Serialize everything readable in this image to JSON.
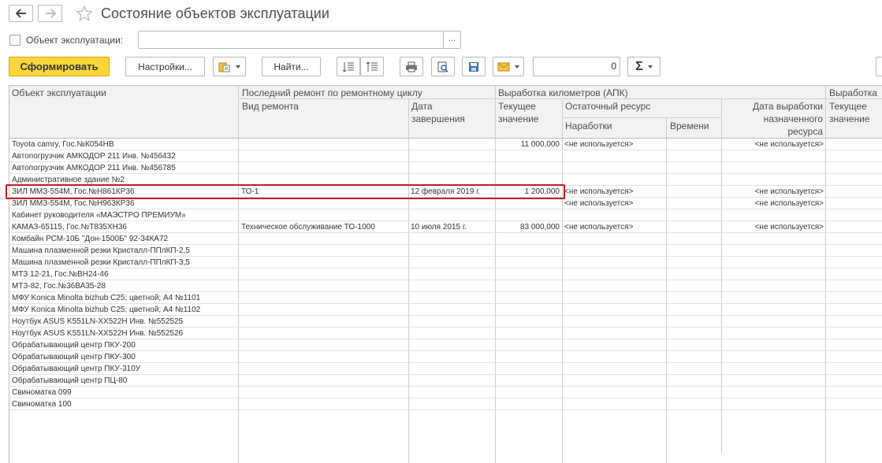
{
  "header": {
    "title": "Состояние объектов эксплуатации"
  },
  "filter": {
    "label": "Объект эксплуатации:",
    "value": "",
    "select_label": "..."
  },
  "toolbar": {
    "generate_label": "Сформировать",
    "settings_label": "Настройки...",
    "find_label": "Найти...",
    "amount_value": "0",
    "sum_label": "Σ"
  },
  "table": {
    "headers": {
      "object": "Объект эксплуатации",
      "last_repair": "Последний ремонт по ремонтному циклу",
      "repair_type": "Вид ремонта",
      "completion_date_1": "Дата",
      "completion_date_2": "завершения",
      "mileage": "Выработка километров (АПК)",
      "current_1": "Текущее",
      "current_2": "значение",
      "remaining": "Остаточный ресурс",
      "operating": "Наработки",
      "time": "Времени",
      "resource_date_1": "Дата выработки",
      "resource_date_2": "назначенного",
      "resource_date_3": "ресурса",
      "mileage_next": "Выработка",
      "current_next_1": "Текущее",
      "current_next_2": "значение"
    },
    "rows": [
      {
        "object": "Toyota camry, Гос.№К054НВ",
        "repair_type": "",
        "date": "",
        "current": "11 000,000",
        "operating": "<не используется>",
        "resource_date": "<не используется>"
      },
      {
        "object": "Автопогрузчик АМКОДОР 211 Инв. №456432",
        "repair_type": "",
        "date": "",
        "current": "",
        "operating": "",
        "resource_date": ""
      },
      {
        "object": "Автопогрузчик АМКОДОР 211 Инв. №456785",
        "repair_type": "",
        "date": "",
        "current": "",
        "operating": "",
        "resource_date": ""
      },
      {
        "object": "Административное здание №2",
        "repair_type": "",
        "date": "",
        "current": "",
        "operating": "",
        "resource_date": ""
      },
      {
        "object": "ЗИЛ ММЗ-554М, Гос.№Н861КР36",
        "repair_type": "ТО-1",
        "date": "12 февраля 2019 г.",
        "current": "1 200,000",
        "operating": "<не используется>",
        "resource_date": "<не используется>"
      },
      {
        "object": "ЗИЛ ММЗ-554М, Гос.№Н963КР36",
        "repair_type": "",
        "date": "",
        "current": "",
        "operating": "<не используется>",
        "resource_date": "<не используется>"
      },
      {
        "object": "Кабинет руководителя «МАЭСТРО ПРЕМИУМ»",
        "repair_type": "",
        "date": "",
        "current": "",
        "operating": "",
        "resource_date": ""
      },
      {
        "object": "КАМАЗ-65115, Гос.№Т835ХН36",
        "repair_type": "Техническое обслуживание ТО-1000",
        "date": "10 июля 2015 г.",
        "current": "83 000,000",
        "operating": "<не используется>",
        "resource_date": "<не используется>"
      },
      {
        "object": "Комбайн РСМ-10Б \"Дон-1500Б\" 92-34КА72",
        "repair_type": "",
        "date": "",
        "current": "",
        "operating": "",
        "resource_date": ""
      },
      {
        "object": "Машина плазменной резки Кристалл-ППлКП-2,5",
        "repair_type": "",
        "date": "",
        "current": "",
        "operating": "",
        "resource_date": ""
      },
      {
        "object": "Машина плазменной резки Кристалл-ППлКП-3,5",
        "repair_type": "",
        "date": "",
        "current": "",
        "operating": "",
        "resource_date": ""
      },
      {
        "object": "МТЗ 12-21, Гос.№ВН24-46",
        "repair_type": "",
        "date": "",
        "current": "",
        "operating": "",
        "resource_date": ""
      },
      {
        "object": "МТЗ-82, Гос.№36ВА35-28",
        "repair_type": "",
        "date": "",
        "current": "",
        "operating": "",
        "resource_date": ""
      },
      {
        "object": "МФУ Konica Minolta bizhub C25; цветной; A4  №1101",
        "repair_type": "",
        "date": "",
        "current": "",
        "operating": "",
        "resource_date": ""
      },
      {
        "object": "МФУ Konica Minolta bizhub C25; цветной; A4  №1102",
        "repair_type": "",
        "date": "",
        "current": "",
        "operating": "",
        "resource_date": ""
      },
      {
        "object": "Ноутбук ASUS K551LN-XX522H Инв. №552525",
        "repair_type": "",
        "date": "",
        "current": "",
        "operating": "",
        "resource_date": ""
      },
      {
        "object": "Ноутбук ASUS K551LN-XX522H Инв. №552526",
        "repair_type": "",
        "date": "",
        "current": "",
        "operating": "",
        "resource_date": ""
      },
      {
        "object": "Обрабатывающий центр ПКУ-200",
        "repair_type": "",
        "date": "",
        "current": "",
        "operating": "",
        "resource_date": ""
      },
      {
        "object": "Обрабатывающий центр ПКУ-300",
        "repair_type": "",
        "date": "",
        "current": "",
        "operating": "",
        "resource_date": ""
      },
      {
        "object": "Обрабатывающий центр ПКУ-310У",
        "repair_type": "",
        "date": "",
        "current": "",
        "operating": "",
        "resource_date": ""
      },
      {
        "object": "Обрабатывающий центр ПЦ-80",
        "repair_type": "",
        "date": "",
        "current": "",
        "operating": "",
        "resource_date": ""
      },
      {
        "object": "Свиноматка 099",
        "repair_type": "",
        "date": "",
        "current": "",
        "operating": "",
        "resource_date": ""
      },
      {
        "object": "Свиноматка 100",
        "repair_type": "",
        "date": "",
        "current": "",
        "operating": "",
        "resource_date": ""
      }
    ]
  }
}
